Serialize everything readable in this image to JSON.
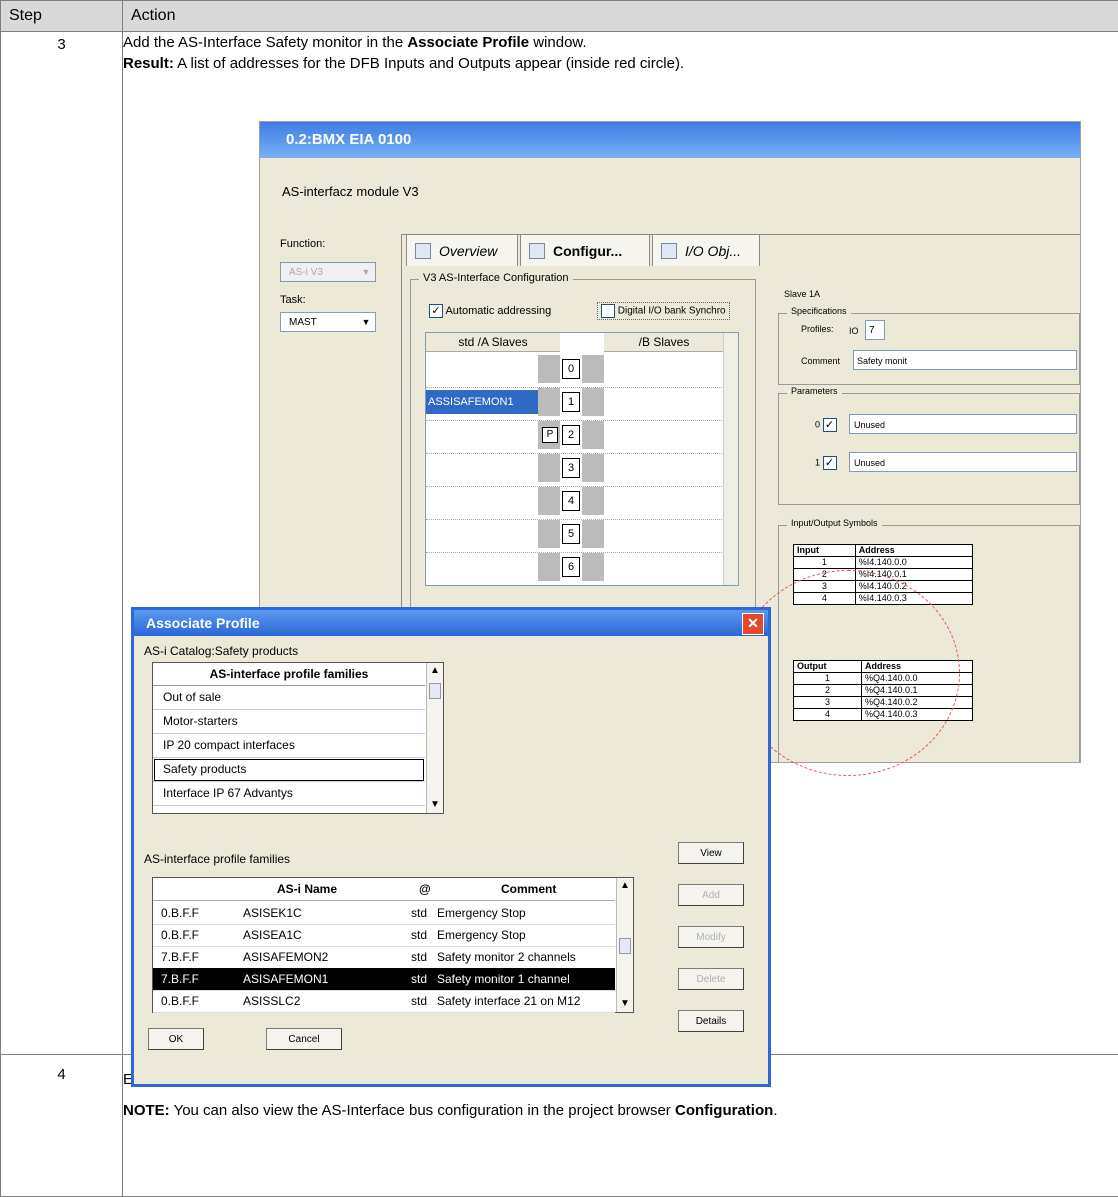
{
  "header": {
    "step": "Step",
    "action": "Action"
  },
  "step3": {
    "number": "3",
    "line1_pre": "Add the AS-Interface Safety monitor in the ",
    "line1_bold": "Associate Profile",
    "line1_post": " window.",
    "line2_bold": "Result:",
    "line2_rest": " A list of addresses for the DFB Inputs and Outputs appear (inside red circle)."
  },
  "step4": {
    "number": "4",
    "line1": "Enter the AS-Interface configuration settings",
    "note_label": "NOTE:",
    "note_text": " You can also view the AS-Interface bus configuration in the project browser ",
    "note_bold": "Configuration",
    "note_end": "."
  },
  "module_window": {
    "title": "0.2:BMX EIA 0100",
    "subtitle": "AS-interfacz module V3",
    "function_label": "Function:",
    "function_value": "AS-i V3",
    "task_label": "Task:",
    "task_value": "MAST",
    "tabs": [
      "Overview",
      "Configur...",
      "I/O Obj..."
    ],
    "config_group": "V3 AS-Interface Configuration",
    "automatic_addressing": "Automatic addressing",
    "digital_bank": "Digital I/O bank Synchro",
    "col_a": "std /A Slaves",
    "col_b": "/B Slaves",
    "slaves": [
      {
        "num": "0",
        "name": ""
      },
      {
        "num": "1",
        "name": "ASSISAFEMON1"
      },
      {
        "num": "2",
        "name": "",
        "tag": "P"
      },
      {
        "num": "3",
        "name": ""
      },
      {
        "num": "4",
        "name": ""
      },
      {
        "num": "5",
        "name": ""
      },
      {
        "num": "6",
        "name": ""
      }
    ],
    "slave_label": "Slave 1A",
    "specs_group": "Specifications",
    "profiles_label": "Profiles:",
    "profiles_io": "IO",
    "profiles_val": "7",
    "comment_label": "Comment",
    "comment_val": "Safety monit",
    "params_group": "Parameters",
    "params": [
      {
        "idx": "0",
        "val": "Unused"
      },
      {
        "idx": "1",
        "val": "Unused"
      }
    ],
    "io_group": "Input/Output Symbols",
    "input_hdr": [
      "Input",
      "Address"
    ],
    "inputs": [
      [
        "1",
        "%I4.140.0.0"
      ],
      [
        "2",
        "%I4.140.0.1"
      ],
      [
        "3",
        "%I4.140.0.2"
      ],
      [
        "4",
        "%I4.140.0.3"
      ]
    ],
    "output_hdr": [
      "Output",
      "Address"
    ],
    "outputs": [
      [
        "1",
        "%Q4.140.0.0"
      ],
      [
        "2",
        "%Q4.140.0.1"
      ],
      [
        "3",
        "%Q4.140.0.2"
      ],
      [
        "4",
        "%Q4.140.0.3"
      ]
    ]
  },
  "dialog": {
    "title": "Associate Profile",
    "catalog_label": "AS-i Catalog:Safety products",
    "families_header": "AS-interface profile families",
    "families": [
      "Out of sale",
      "Motor-starters",
      "IP 20 compact interfaces",
      "Safety products",
      "Interface IP 67 Advantys"
    ],
    "table_label": "AS-interface profile families",
    "table_headers": [
      "AS-i Name",
      "@",
      "Comment"
    ],
    "rows": [
      [
        "0.B.F.F",
        "ASISEK1C",
        "std",
        "Emergency Stop"
      ],
      [
        "0.B.F.F",
        "ASISEA1C",
        "std",
        "Emergency Stop"
      ],
      [
        "7.B.F.F",
        "ASISAFEMON2",
        "std",
        "Safety monitor 2 channels"
      ],
      [
        "7.B.F.F",
        "ASISAFEMON1",
        "std",
        "Safety monitor 1 channel"
      ],
      [
        "0.B.F.F",
        "ASISSLC2",
        "std",
        "Safety interface 21 on M12"
      ]
    ],
    "buttons": {
      "view": "View",
      "add": "Add",
      "modify": "Modify",
      "delete": "Delete",
      "details": "Details",
      "ok": "OK",
      "cancel": "Cancel"
    }
  }
}
